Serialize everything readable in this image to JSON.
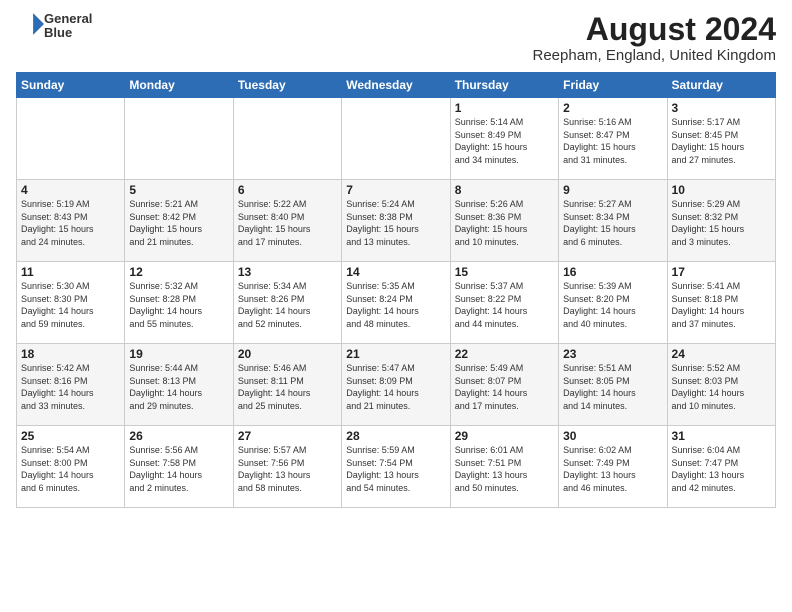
{
  "header": {
    "logo_line1": "General",
    "logo_line2": "Blue",
    "month_year": "August 2024",
    "location": "Reepham, England, United Kingdom"
  },
  "weekdays": [
    "Sunday",
    "Monday",
    "Tuesday",
    "Wednesday",
    "Thursday",
    "Friday",
    "Saturday"
  ],
  "weeks": [
    [
      {
        "day": "",
        "info": ""
      },
      {
        "day": "",
        "info": ""
      },
      {
        "day": "",
        "info": ""
      },
      {
        "day": "",
        "info": ""
      },
      {
        "day": "1",
        "info": "Sunrise: 5:14 AM\nSunset: 8:49 PM\nDaylight: 15 hours\nand 34 minutes."
      },
      {
        "day": "2",
        "info": "Sunrise: 5:16 AM\nSunset: 8:47 PM\nDaylight: 15 hours\nand 31 minutes."
      },
      {
        "day": "3",
        "info": "Sunrise: 5:17 AM\nSunset: 8:45 PM\nDaylight: 15 hours\nand 27 minutes."
      }
    ],
    [
      {
        "day": "4",
        "info": "Sunrise: 5:19 AM\nSunset: 8:43 PM\nDaylight: 15 hours\nand 24 minutes."
      },
      {
        "day": "5",
        "info": "Sunrise: 5:21 AM\nSunset: 8:42 PM\nDaylight: 15 hours\nand 21 minutes."
      },
      {
        "day": "6",
        "info": "Sunrise: 5:22 AM\nSunset: 8:40 PM\nDaylight: 15 hours\nand 17 minutes."
      },
      {
        "day": "7",
        "info": "Sunrise: 5:24 AM\nSunset: 8:38 PM\nDaylight: 15 hours\nand 13 minutes."
      },
      {
        "day": "8",
        "info": "Sunrise: 5:26 AM\nSunset: 8:36 PM\nDaylight: 15 hours\nand 10 minutes."
      },
      {
        "day": "9",
        "info": "Sunrise: 5:27 AM\nSunset: 8:34 PM\nDaylight: 15 hours\nand 6 minutes."
      },
      {
        "day": "10",
        "info": "Sunrise: 5:29 AM\nSunset: 8:32 PM\nDaylight: 15 hours\nand 3 minutes."
      }
    ],
    [
      {
        "day": "11",
        "info": "Sunrise: 5:30 AM\nSunset: 8:30 PM\nDaylight: 14 hours\nand 59 minutes."
      },
      {
        "day": "12",
        "info": "Sunrise: 5:32 AM\nSunset: 8:28 PM\nDaylight: 14 hours\nand 55 minutes."
      },
      {
        "day": "13",
        "info": "Sunrise: 5:34 AM\nSunset: 8:26 PM\nDaylight: 14 hours\nand 52 minutes."
      },
      {
        "day": "14",
        "info": "Sunrise: 5:35 AM\nSunset: 8:24 PM\nDaylight: 14 hours\nand 48 minutes."
      },
      {
        "day": "15",
        "info": "Sunrise: 5:37 AM\nSunset: 8:22 PM\nDaylight: 14 hours\nand 44 minutes."
      },
      {
        "day": "16",
        "info": "Sunrise: 5:39 AM\nSunset: 8:20 PM\nDaylight: 14 hours\nand 40 minutes."
      },
      {
        "day": "17",
        "info": "Sunrise: 5:41 AM\nSunset: 8:18 PM\nDaylight: 14 hours\nand 37 minutes."
      }
    ],
    [
      {
        "day": "18",
        "info": "Sunrise: 5:42 AM\nSunset: 8:16 PM\nDaylight: 14 hours\nand 33 minutes."
      },
      {
        "day": "19",
        "info": "Sunrise: 5:44 AM\nSunset: 8:13 PM\nDaylight: 14 hours\nand 29 minutes."
      },
      {
        "day": "20",
        "info": "Sunrise: 5:46 AM\nSunset: 8:11 PM\nDaylight: 14 hours\nand 25 minutes."
      },
      {
        "day": "21",
        "info": "Sunrise: 5:47 AM\nSunset: 8:09 PM\nDaylight: 14 hours\nand 21 minutes."
      },
      {
        "day": "22",
        "info": "Sunrise: 5:49 AM\nSunset: 8:07 PM\nDaylight: 14 hours\nand 17 minutes."
      },
      {
        "day": "23",
        "info": "Sunrise: 5:51 AM\nSunset: 8:05 PM\nDaylight: 14 hours\nand 14 minutes."
      },
      {
        "day": "24",
        "info": "Sunrise: 5:52 AM\nSunset: 8:03 PM\nDaylight: 14 hours\nand 10 minutes."
      }
    ],
    [
      {
        "day": "25",
        "info": "Sunrise: 5:54 AM\nSunset: 8:00 PM\nDaylight: 14 hours\nand 6 minutes."
      },
      {
        "day": "26",
        "info": "Sunrise: 5:56 AM\nSunset: 7:58 PM\nDaylight: 14 hours\nand 2 minutes."
      },
      {
        "day": "27",
        "info": "Sunrise: 5:57 AM\nSunset: 7:56 PM\nDaylight: 13 hours\nand 58 minutes."
      },
      {
        "day": "28",
        "info": "Sunrise: 5:59 AM\nSunset: 7:54 PM\nDaylight: 13 hours\nand 54 minutes."
      },
      {
        "day": "29",
        "info": "Sunrise: 6:01 AM\nSunset: 7:51 PM\nDaylight: 13 hours\nand 50 minutes."
      },
      {
        "day": "30",
        "info": "Sunrise: 6:02 AM\nSunset: 7:49 PM\nDaylight: 13 hours\nand 46 minutes."
      },
      {
        "day": "31",
        "info": "Sunrise: 6:04 AM\nSunset: 7:47 PM\nDaylight: 13 hours\nand 42 minutes."
      }
    ]
  ]
}
